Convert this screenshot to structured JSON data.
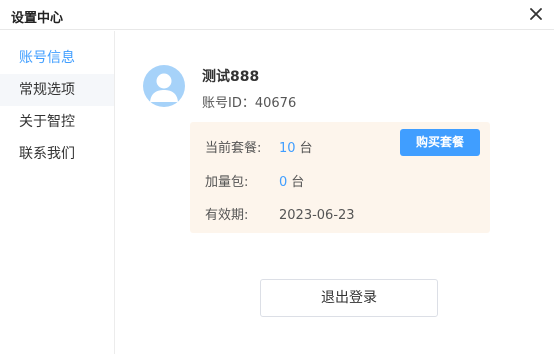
{
  "window": {
    "title": "设置中心",
    "close_icon": "close-icon"
  },
  "sidebar": {
    "items": [
      {
        "label": "账号信息",
        "active": true
      },
      {
        "label": "常规选项",
        "active": false
      },
      {
        "label": "关于智控",
        "active": false
      },
      {
        "label": "联系我们",
        "active": false
      }
    ]
  },
  "account": {
    "avatar_icon": "user-avatar-icon",
    "username": "测试888",
    "id_label": "账号ID：",
    "id_value": "40676",
    "plan_label": "当前套餐:",
    "plan_value": "10",
    "plan_unit": "台",
    "addon_label": "加量包:",
    "addon_value": "0",
    "addon_unit": "台",
    "expiry_label": "有效期:",
    "expiry_value": "2023-06-23",
    "buy_button": "购买套餐",
    "logout_button": "退出登录"
  },
  "colors": {
    "accent": "#409eff",
    "card_bg": "#fdf5ec",
    "avatar_bg": "#a6d2f9"
  }
}
